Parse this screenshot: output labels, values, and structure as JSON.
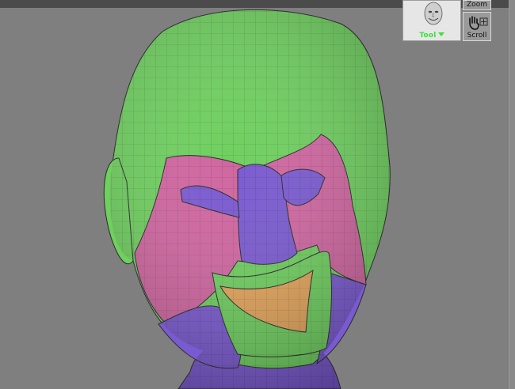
{
  "viewport": {
    "topbar_color": "#4b4b4b",
    "background_color": "#7f7f7f",
    "model": "sculpted face with polygroup colors",
    "polygroup_colors": {
      "green": "#6fcf5f",
      "pink": "#d066a0",
      "purple": "#7a5ad0",
      "orange": "#e3a45a"
    }
  },
  "tool_panel": {
    "label": "Tool",
    "thumbnail_icon": "head-thumbnail-icon",
    "label_color": "#39e239"
  },
  "buttons": {
    "zoom_label": "Zoom",
    "scroll_label": "Scroll",
    "scroll_icon": "hand-icon"
  }
}
